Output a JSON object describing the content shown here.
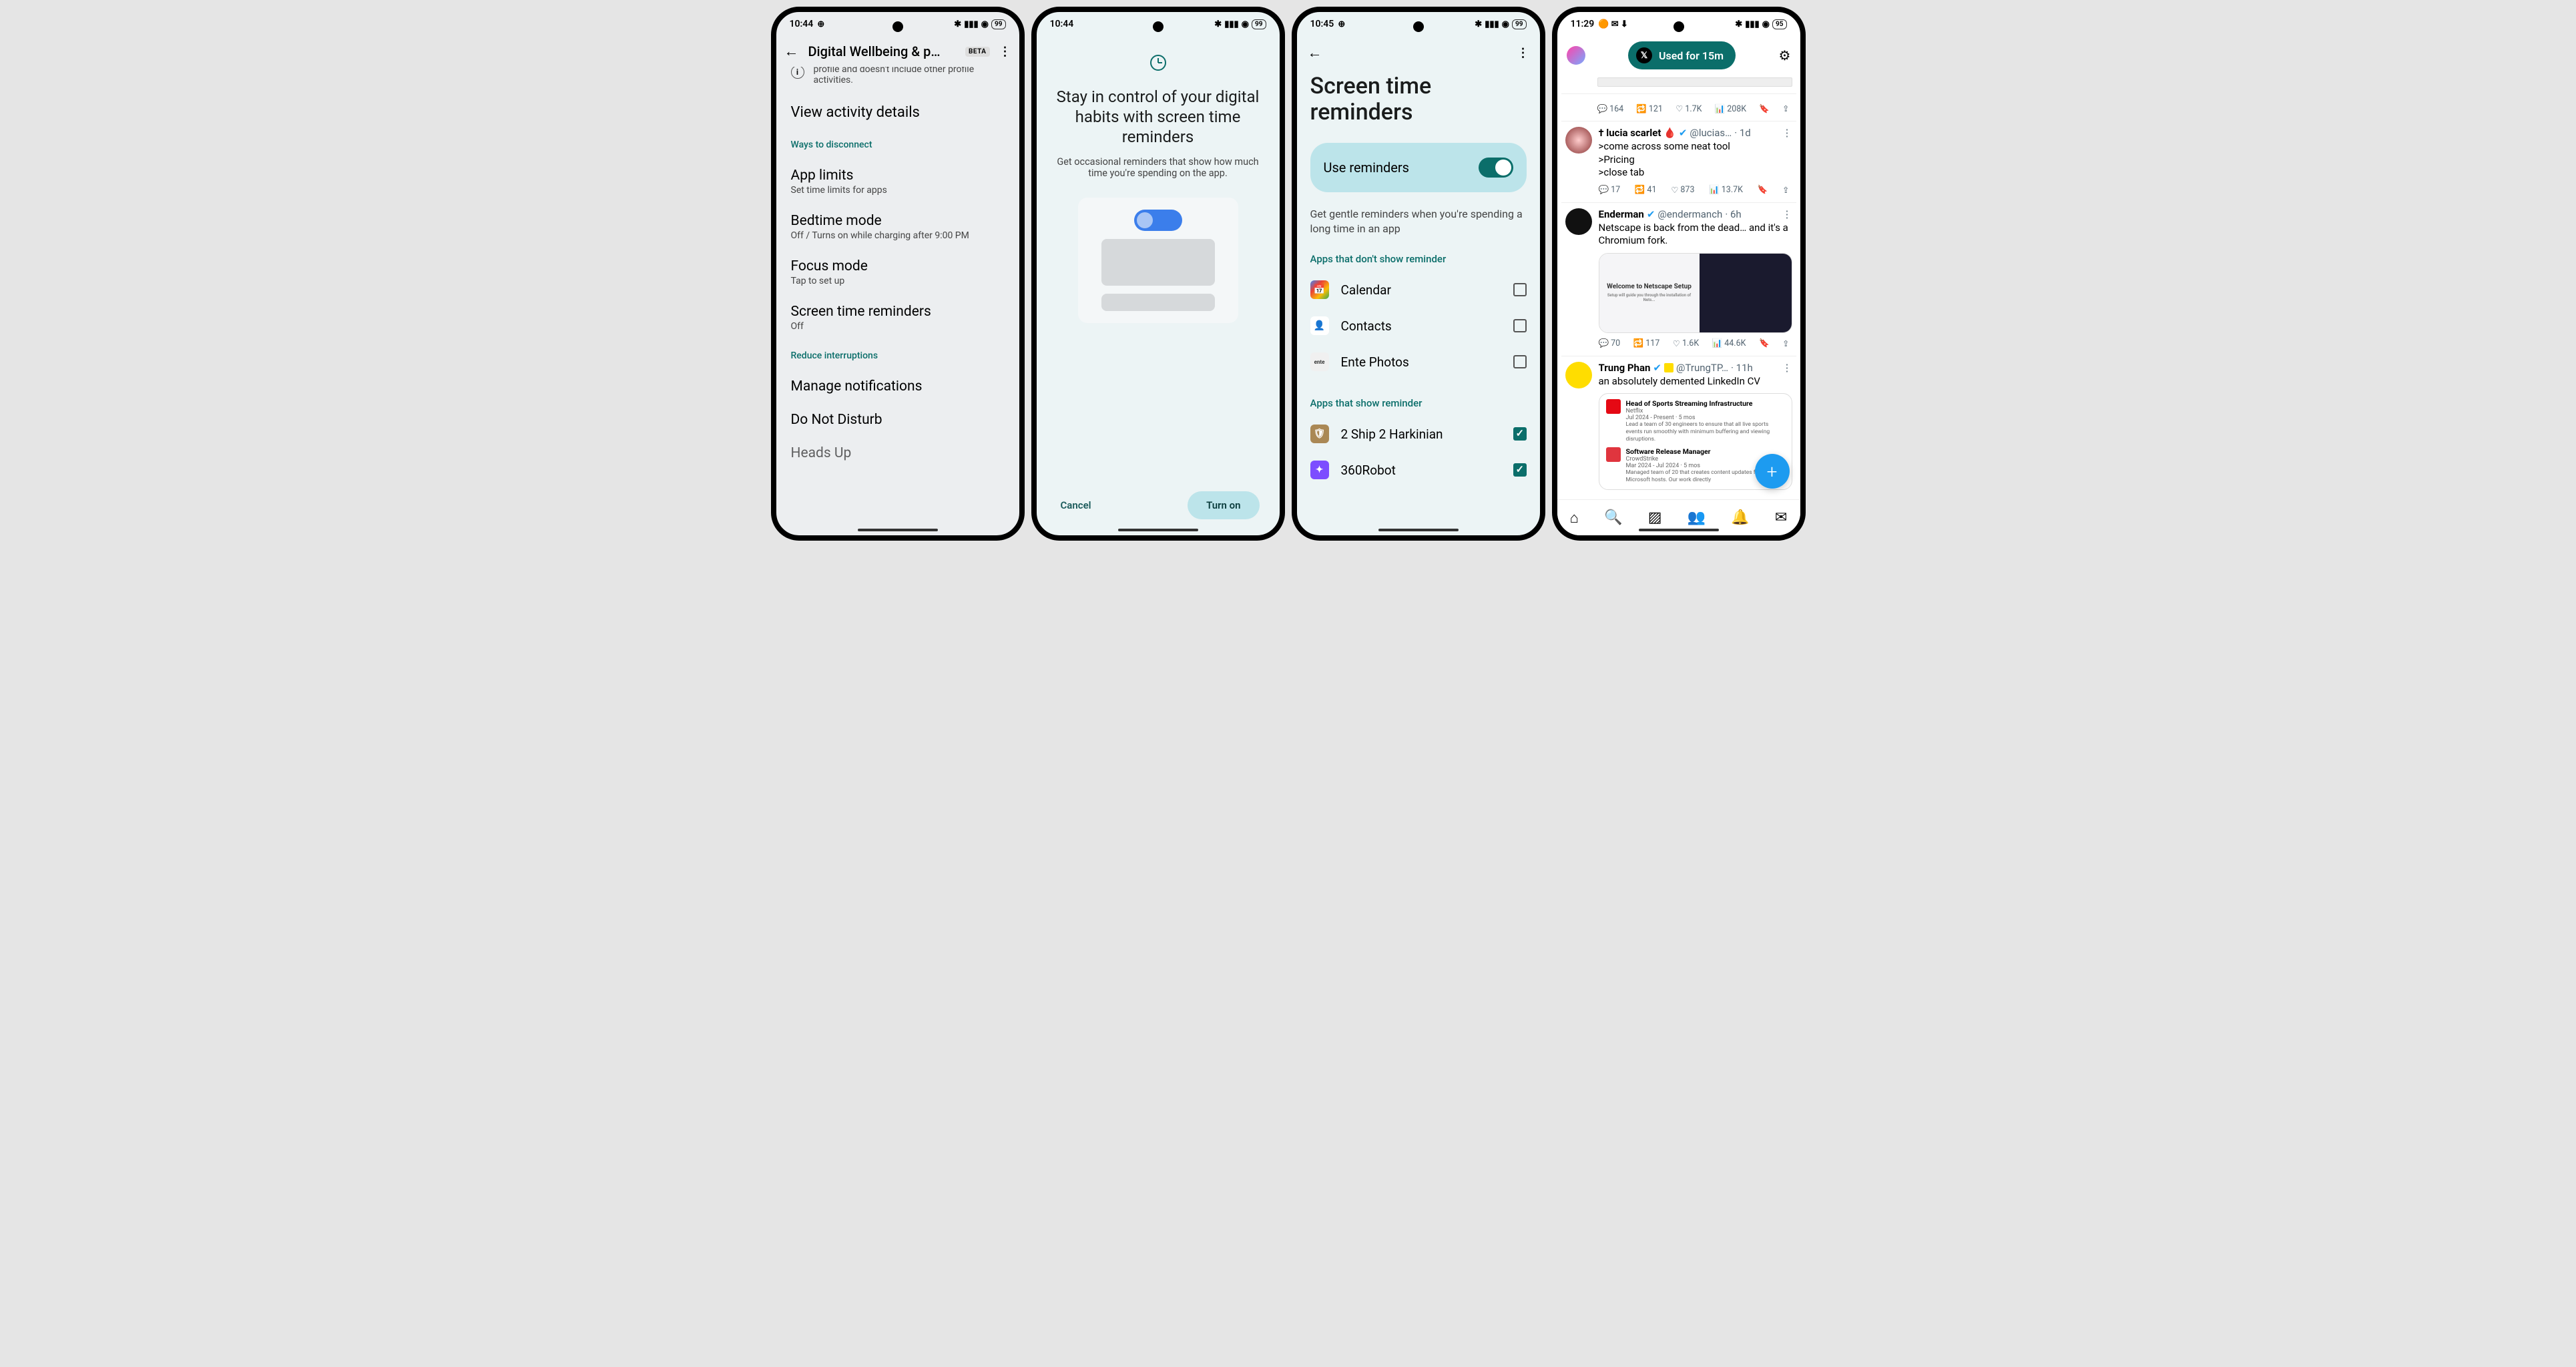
{
  "phone1": {
    "time": "10:44",
    "battery": "99",
    "title": "Digital Wellbeing & p…",
    "beta": "BETA",
    "info_text": "profile and doesn't include other profile activities.",
    "view_activity": "View activity details",
    "section_disconnect": "Ways to disconnect",
    "app_limits": {
      "title": "App limits",
      "sub": "Set time limits for apps"
    },
    "bedtime": {
      "title": "Bedtime mode",
      "sub": "Off / Turns on while charging after 9:00 PM"
    },
    "focus": {
      "title": "Focus mode",
      "sub": "Tap to set up"
    },
    "screen_time": {
      "title": "Screen time reminders",
      "sub": "Off"
    },
    "section_reduce": "Reduce interruptions",
    "manage_notifs": "Manage notifications",
    "dnd": "Do Not Disturb",
    "heads_up": "Heads Up"
  },
  "phone2": {
    "time": "10:44",
    "battery": "99",
    "heading": "Stay in control of your digital habits with screen time reminders",
    "sub": "Get occasional reminders that show how much time you're spending on the app.",
    "cancel": "Cancel",
    "turn_on": "Turn on"
  },
  "phone3": {
    "time": "10:45",
    "battery": "99",
    "title": "Screen time reminders",
    "toggle_label": "Use reminders",
    "desc": "Get gentle reminders when you're spending a long time in an app",
    "section_no_reminder": "Apps that don't show reminder",
    "apps_no": [
      {
        "name": "Calendar",
        "color": "#1a73e8"
      },
      {
        "name": "Contacts",
        "color": "#1a73e8"
      },
      {
        "name": "Ente Photos",
        "color": "#f0f0f0"
      }
    ],
    "section_reminder": "Apps that show reminder",
    "apps_yes": [
      {
        "name": "2 Ship 2 Harkinian",
        "color": "#a54"
      },
      {
        "name": "360Robot",
        "color": "#7c4dff"
      }
    ]
  },
  "phone4": {
    "time": "11:29",
    "battery": "95",
    "pill_text": "Used for 15m",
    "tweet0_actions": {
      "reply": "164",
      "rt": "121",
      "like": "1.7K",
      "views": "208K"
    },
    "tweet1": {
      "name": "† lucia scarlet 🩸",
      "handle": "@lucias…",
      "time": "1d",
      "text": ">come across some neat tool\n>Pricing\n>close tab",
      "reply": "17",
      "rt": "41",
      "like": "873",
      "views": "13.7K"
    },
    "tweet2": {
      "name": "Enderman",
      "handle": "@endermanch",
      "time": "6h",
      "text": "Netscape is back from the dead… and it's a Chromium fork.",
      "media_text": "Welcome to Netscape Setup",
      "reply": "70",
      "rt": "117",
      "like": "1.6K",
      "views": "44.6K"
    },
    "tweet3": {
      "name": "Trung Phan",
      "handle": "@TrungTP…",
      "time": "11h",
      "text": "an absolutely demented LinkedIn CV",
      "cv1_title": "Head of Sports Streaming Infrastructure",
      "cv1_co": "Netflix",
      "cv1_dates": "Jul 2024 - Present · 5 mos",
      "cv1_desc": "Lead a team of 30 engineers to ensure that all live sports events run smoothly with minimum buffering and viewing disruptions.",
      "cv2_title": "Software Release Manager",
      "cv2_co": "CrowdStrike",
      "cv2_dates": "Mar 2024 - Jul 2024 · 5 mos",
      "cv2_desc": "Managed team of 20 that creates content updates for Microsoft hosts. Our work directly"
    }
  }
}
